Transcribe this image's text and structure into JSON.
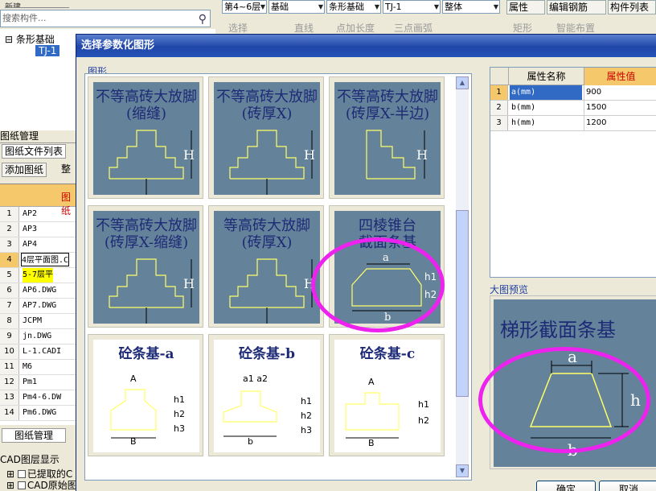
{
  "app": {
    "left_top_label": "新建",
    "search_placeholder": "搜索构件...",
    "toolbar_combos": [
      "第4~6层",
      "基础",
      "条形基础",
      "TJ-1",
      "整体"
    ],
    "right_buttons": [
      "属性",
      "编辑钢筋",
      "构件列表"
    ],
    "tool2": [
      "选择",
      "直线",
      "点加长度",
      "三点画弧",
      "矩形",
      "智能布置"
    ],
    "tree": {
      "parent": "条形基础",
      "child": "TJ-1"
    },
    "drawings_title": "图纸管理",
    "drawings_tab": "图纸文件列表",
    "add_drawing": "添加图纸",
    "tidy": "整",
    "table_header": "图纸",
    "rows": [
      {
        "num": "1",
        "name": "AP2"
      },
      {
        "num": "2",
        "name": "AP3"
      },
      {
        "num": "3",
        "name": "AP4"
      },
      {
        "num": "4",
        "name": "4层平面图.C"
      },
      {
        "num": "5",
        "name": "5-7层平"
      },
      {
        "num": "6",
        "name": "AP6.DWG"
      },
      {
        "num": "7",
        "name": "AP7.DWG"
      },
      {
        "num": "8",
        "name": "JCPM"
      },
      {
        "num": "9",
        "name": "jn.DWG"
      },
      {
        "num": "10",
        "name": "L-1.CADI"
      },
      {
        "num": "11",
        "name": "M6"
      },
      {
        "num": "12",
        "name": "Pm1"
      },
      {
        "num": "13",
        "name": "Pm4-6.DW"
      },
      {
        "num": "14",
        "name": "Pm6.DWG"
      }
    ],
    "bottom_tab": "图纸管理",
    "cad_title": "CAD图层显示",
    "cad_items": [
      "已提取的C",
      "CAD原始图"
    ]
  },
  "dialog": {
    "title": "选择参数化图形",
    "group_label": "图形",
    "tiles": [
      {
        "name": "不等高砖大放脚(缩缝)",
        "text": "不等高砖大放脚\n(缩缝)",
        "light": false
      },
      {
        "name": "不等高砖大放脚(砖厚X)",
        "text": "不等高砖大放脚\n(砖厚X)",
        "light": false
      },
      {
        "name": "不等高砖大放脚(砖厚X-半边)",
        "text": "不等高砖大放脚\n(砖厚X-半边)",
        "light": false
      },
      {
        "name": "不等高砖大放脚(砖厚X-缩缝)",
        "text": "不等高砖大放脚\n(砖厚X-缩缝)",
        "light": false
      },
      {
        "name": "等高砖大放脚(砖厚X)",
        "text": "等高砖大放脚\n(砖厚X)",
        "light": false
      },
      {
        "name": "四棱锥台截面条基",
        "text": "四棱锥台\n截面条基",
        "light": false
      },
      {
        "name": "砼条基-a",
        "text": "砼条基-a",
        "light": true
      },
      {
        "name": "砼条基-b",
        "text": "砼条基-b",
        "light": true
      },
      {
        "name": "砼条基-c",
        "text": "砼条基-c",
        "light": true
      }
    ],
    "props_header": [
      "属性名称",
      "属性值"
    ],
    "props": [
      {
        "idx": "1",
        "name": "a(mm)",
        "value": "900"
      },
      {
        "idx": "2",
        "name": "b(mm)",
        "value": "1500"
      },
      {
        "idx": "3",
        "name": "h(mm)",
        "value": "1200"
      }
    ],
    "preview_label": "大图预览",
    "preview_title": "梯形截面条基",
    "ok": "确定",
    "cancel": "取消",
    "colors": {
      "highlight_circle": "#ee22ee",
      "tile_bg": "#65829b",
      "title_bar": "#1f47a8"
    }
  }
}
